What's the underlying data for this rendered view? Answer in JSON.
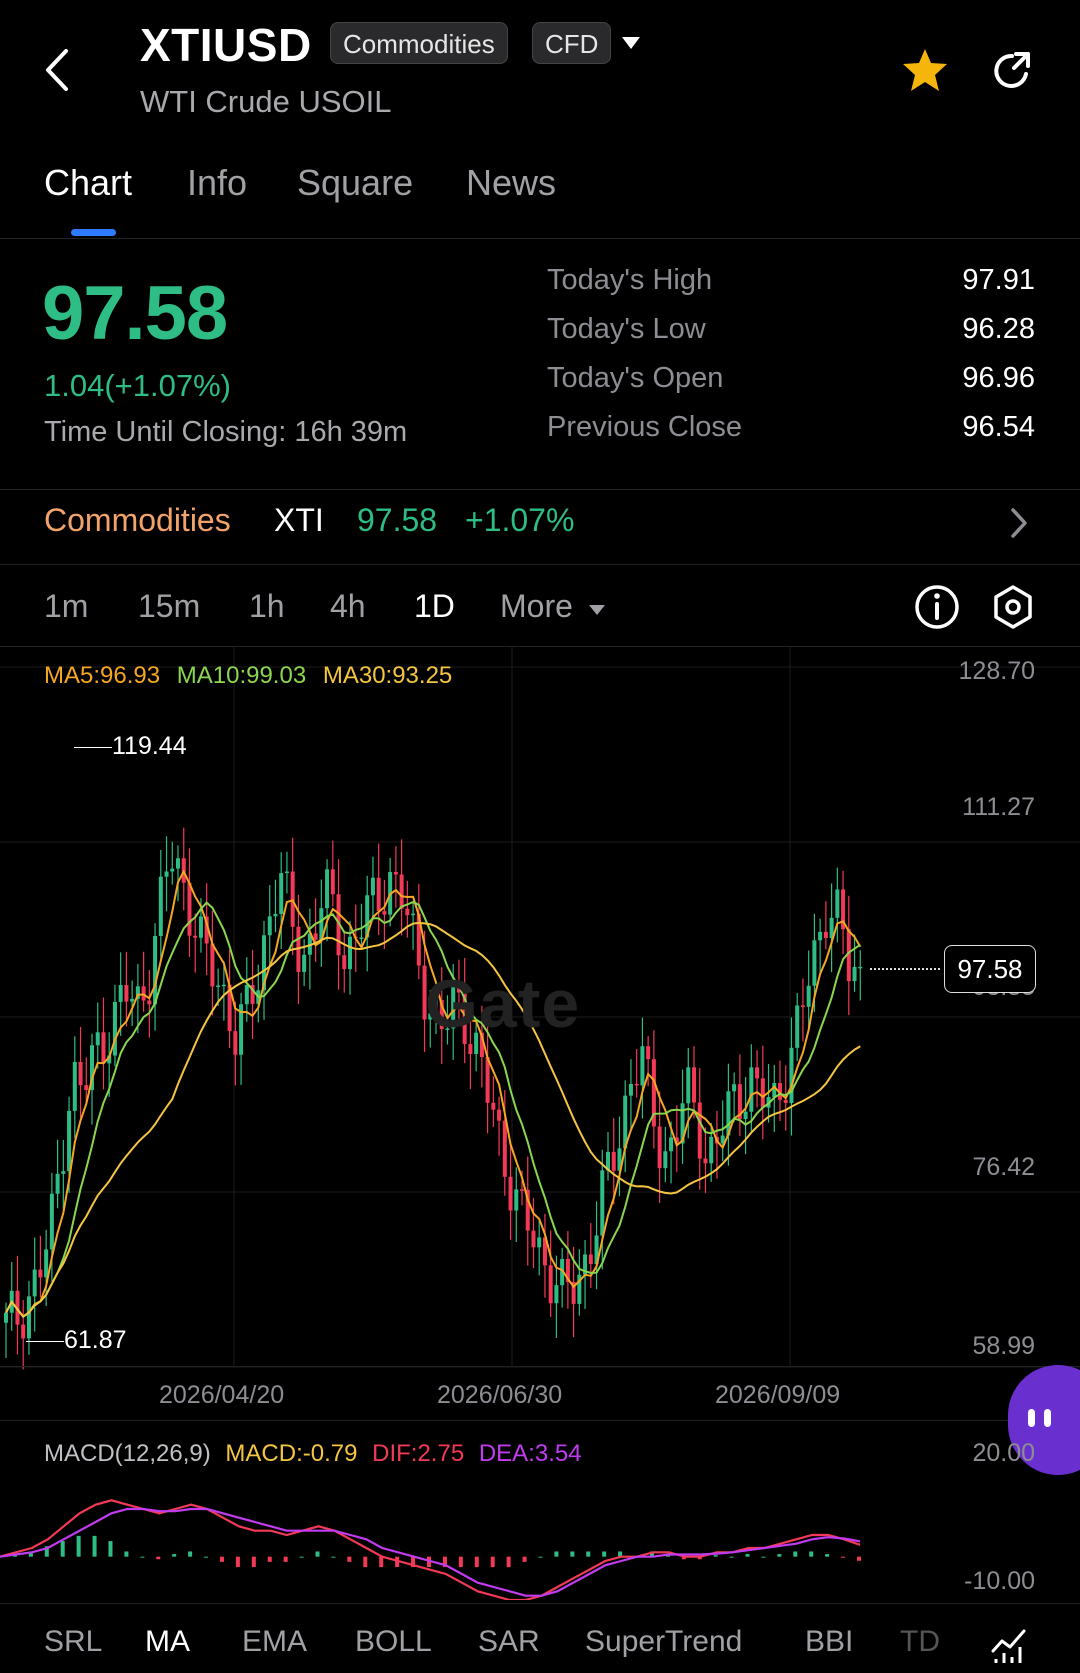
{
  "header": {
    "symbol": "XTIUSD",
    "badge_commodities": "Commodities",
    "badge_cfd": "CFD",
    "subtitle": "WTI Crude USOIL"
  },
  "tabs": [
    {
      "label": "Chart",
      "active": true
    },
    {
      "label": "Info",
      "active": false
    },
    {
      "label": "Square",
      "active": false
    },
    {
      "label": "News",
      "active": false
    }
  ],
  "quote": {
    "price": "97.58",
    "change": "1.04(+1.07%)",
    "closing_label": "Time Until Closing:",
    "closing_value": "16h 39m",
    "stats": [
      {
        "label": "Today's High",
        "value": "97.91"
      },
      {
        "label": "Today's Low",
        "value": "96.28"
      },
      {
        "label": "Today's Open",
        "value": "96.96"
      },
      {
        "label": "Previous Close",
        "value": "96.54"
      }
    ]
  },
  "sector": {
    "category": "Commodities",
    "ticker": "XTI",
    "price": "97.58",
    "change": "+1.07%"
  },
  "periods": [
    {
      "label": "1m",
      "active": false
    },
    {
      "label": "15m",
      "active": false
    },
    {
      "label": "1h",
      "active": false
    },
    {
      "label": "4h",
      "active": false
    },
    {
      "label": "1D",
      "active": true
    },
    {
      "label": "More",
      "active": false
    }
  ],
  "chart_legend": {
    "ma5": "MA5:96.93",
    "ma10": "MA10:99.03",
    "ma30": "MA30:93.25"
  },
  "watermark": "Gate",
  "indicators": [
    "SRL",
    "MA",
    "EMA",
    "BOLL",
    "SAR",
    "SuperTrend",
    "BBI",
    "TD"
  ],
  "active_indicator": "MA",
  "colors": {
    "up": "#2ebd85",
    "down": "#f23a57",
    "ma5": "#f5a623",
    "ma10": "#8bd64f",
    "ma30": "#f5c542",
    "sector": "#f2a36b",
    "accent": "#2f7bff",
    "star": "#f5b50a"
  },
  "chart_data": {
    "type": "candlestick",
    "y_ticks": [
      "128.70",
      "111.27",
      "93.85",
      "76.42",
      "58.99"
    ],
    "ylim": [
      58.99,
      128.7
    ],
    "x_ticks": [
      "2026/04/20",
      "2026/06/30",
      "2026/09/09"
    ],
    "high_marker": "119.44",
    "low_marker": "61.87",
    "last_price": "97.58",
    "series": [
      {
        "name": "MA5",
        "last": 96.93
      },
      {
        "name": "MA10",
        "last": 99.03
      },
      {
        "name": "MA30",
        "last": 93.25
      }
    ],
    "close_path": [
      63,
      64,
      66,
      68,
      72,
      80,
      88,
      86,
      90,
      92,
      94,
      96,
      95,
      98,
      104,
      110,
      108,
      104,
      100,
      98,
      96,
      92,
      94,
      98,
      104,
      108,
      103,
      100,
      102,
      106,
      104,
      100,
      102,
      104,
      106,
      108,
      106,
      102,
      98,
      94,
      92,
      96,
      94,
      90,
      86,
      82,
      78,
      74,
      72,
      70,
      68,
      66,
      67,
      70,
      74,
      78,
      82,
      88,
      90,
      84,
      80,
      82,
      86,
      84,
      80,
      82,
      84,
      86,
      88,
      86,
      84,
      88,
      92,
      96,
      100,
      106,
      104,
      98,
      97.58
    ],
    "macd": {
      "label": "MACD(12,26,9)",
      "macd_label": "MACD:-0.79",
      "dif_label": "DIF:2.75",
      "dea_label": "DEA:3.54",
      "y_ticks": [
        "20.00",
        "-10.00"
      ],
      "ylim": [
        -10,
        20
      ],
      "dif": [
        0,
        1,
        2,
        4,
        7,
        10,
        12,
        13,
        12,
        11,
        10,
        11,
        12,
        11,
        9,
        7,
        6,
        6,
        5,
        6,
        7,
        6,
        4,
        2,
        0,
        -1,
        -2,
        -3,
        -4,
        -6,
        -8,
        -9,
        -10,
        -10,
        -9,
        -7,
        -5,
        -3,
        -1,
        0,
        0,
        1,
        1,
        0,
        0,
        1,
        1,
        2,
        2,
        3,
        4,
        5,
        5,
        4,
        2.75
      ],
      "dea": [
        0,
        0.5,
        1,
        2,
        4,
        6,
        8,
        10,
        11,
        11,
        10.5,
        10.5,
        11,
        11,
        10,
        9,
        8,
        7,
        6,
        6,
        6,
        6,
        5,
        4,
        2,
        1,
        0,
        -1,
        -2,
        -4,
        -6,
        -7,
        -8,
        -9,
        -9,
        -8,
        -6,
        -4,
        -2,
        -1,
        0,
        0,
        0.5,
        0.5,
        0.5,
        0.7,
        1,
        1.5,
        2,
        2.5,
        3,
        4,
        4.5,
        4.2,
        3.54
      ]
    }
  }
}
